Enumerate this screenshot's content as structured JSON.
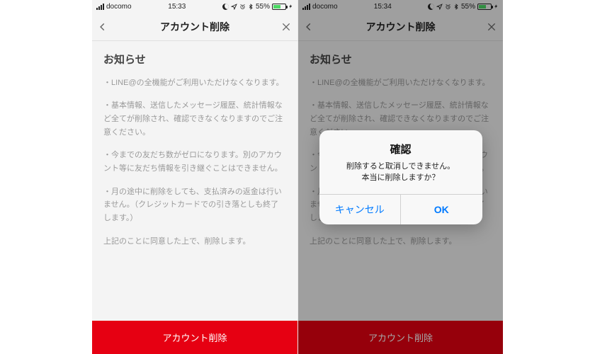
{
  "status": {
    "carrier": "docomo",
    "time_left": "15:33",
    "time_right": "15:34",
    "battery_pct": "55%",
    "battery_fill": "55%"
  },
  "nav": {
    "title": "アカウント削除"
  },
  "notice": {
    "heading": "お知らせ",
    "p1": "・LINE@の全機能がご利用いただけなくなります。",
    "p2": "・基本情報、送信したメッセージ履歴、統計情報など全てが削除され、確認できなくなりますのでご注意ください。",
    "p3": "・今までの友だち数がゼロになります。別のアカウント等に友だち情報を引き継ぐことはできません。",
    "p4": "・月の途中に削除をしても、支払済みの返金は行いません。（クレジットカードでの引き落としも終了します。）",
    "p5": "上記のことに同意した上で、削除します。"
  },
  "buttons": {
    "delete": "アカウント削除"
  },
  "alert": {
    "title": "確認",
    "line1": "削除すると取消しできません。",
    "line2": "本当に削除しますか？",
    "cancel": "キャンセル",
    "ok": "OK"
  }
}
